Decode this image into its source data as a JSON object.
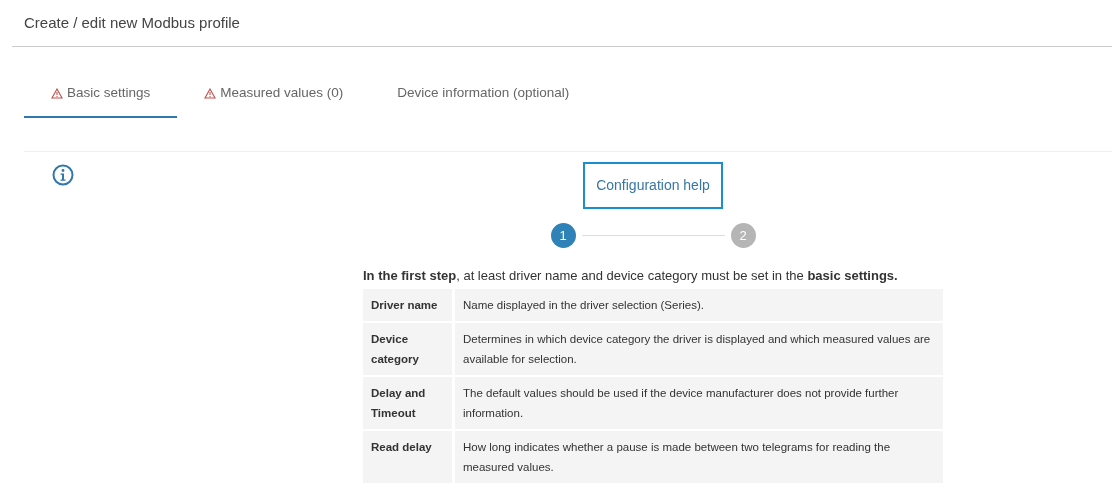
{
  "page_title": "Create / edit new Modbus profile",
  "tabs": [
    {
      "label": "Basic settings",
      "selected": true,
      "warning": true
    },
    {
      "label": "Measured values (0)",
      "selected": false,
      "warning": true
    },
    {
      "label": "Device information (optional)",
      "selected": false,
      "warning": false
    }
  ],
  "help_button": "Configuration help",
  "steps": [
    {
      "label": "1",
      "selected": true
    },
    {
      "label": "2",
      "selected": false
    }
  ],
  "intro": "**In the first step**, at least driver name and device category must be set in the **basic settings.**",
  "table": {
    "rows": [
      {
        "term": "Driver name",
        "description": "Name displayed in the driver selection (Series)."
      },
      {
        "term": "Device category",
        "description": "Determines in which device category the driver is displayed and which measured values are available for selection."
      },
      {
        "term": "Delay and Timeout",
        "description": "The default values should be used if the device manufacturer does not provide further information."
      },
      {
        "term": "Read delay",
        "description": "How long indicates whether a pause is made between two telegrams for reading the measured values."
      }
    ]
  }
}
